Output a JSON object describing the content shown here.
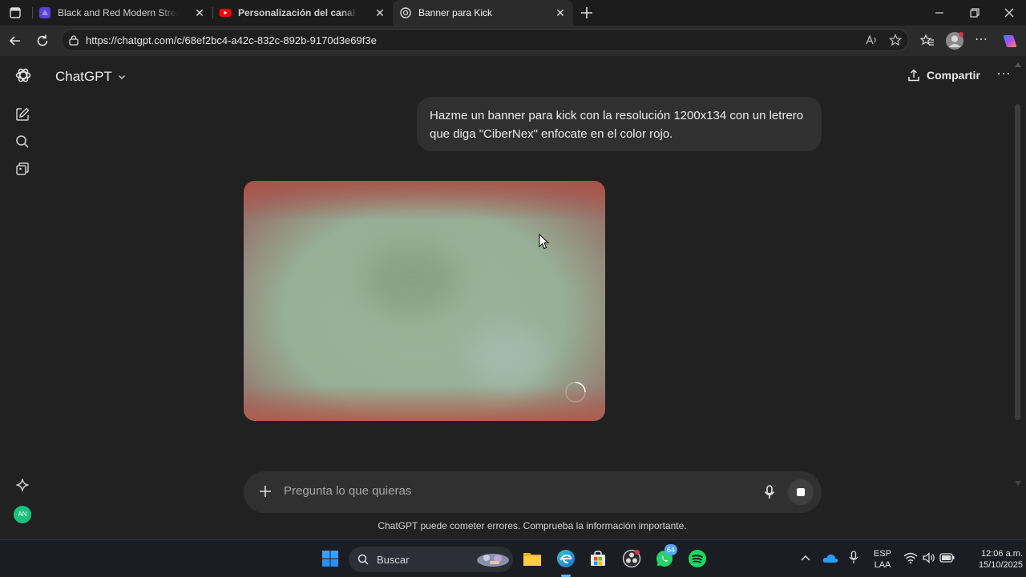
{
  "browser": {
    "tabs": [
      {
        "title": "Black and Red Modern Stream Tw",
        "favicon": "canva-icon",
        "active": false
      },
      {
        "title": "Personalización del canal - YouTu",
        "favicon": "youtube-icon",
        "active": false
      },
      {
        "title": "Banner para Kick",
        "favicon": "chatgpt-icon",
        "active": true
      }
    ],
    "url": "https://chatgpt.com/c/68ef2bc4-a42c-832c-892b-9170d3e69f3e"
  },
  "app": {
    "model_name": "ChatGPT",
    "share_label": "Compartir",
    "user_initials": "AN",
    "user_message": "Hazme un banner para kick con la resolución 1200x134 con un letrero que diga \"CiberNex\" enfocate en el color rojo.",
    "composer_placeholder": "Pregunta lo que quieras",
    "disclaimer": "ChatGPT puede cometer errores. Comprueba la información importante."
  },
  "taskbar": {
    "search_label": "Buscar",
    "whatsapp_badge": "64",
    "language_top": "ESP",
    "language_bottom": "LAA",
    "time": "12:06 a.m.",
    "date": "15/10/2025"
  },
  "colors": {
    "app_bg": "#212121",
    "bubble_bg": "#303030",
    "taskbar_bg": "#1a1d24",
    "avatar_green": "#19c37d"
  }
}
